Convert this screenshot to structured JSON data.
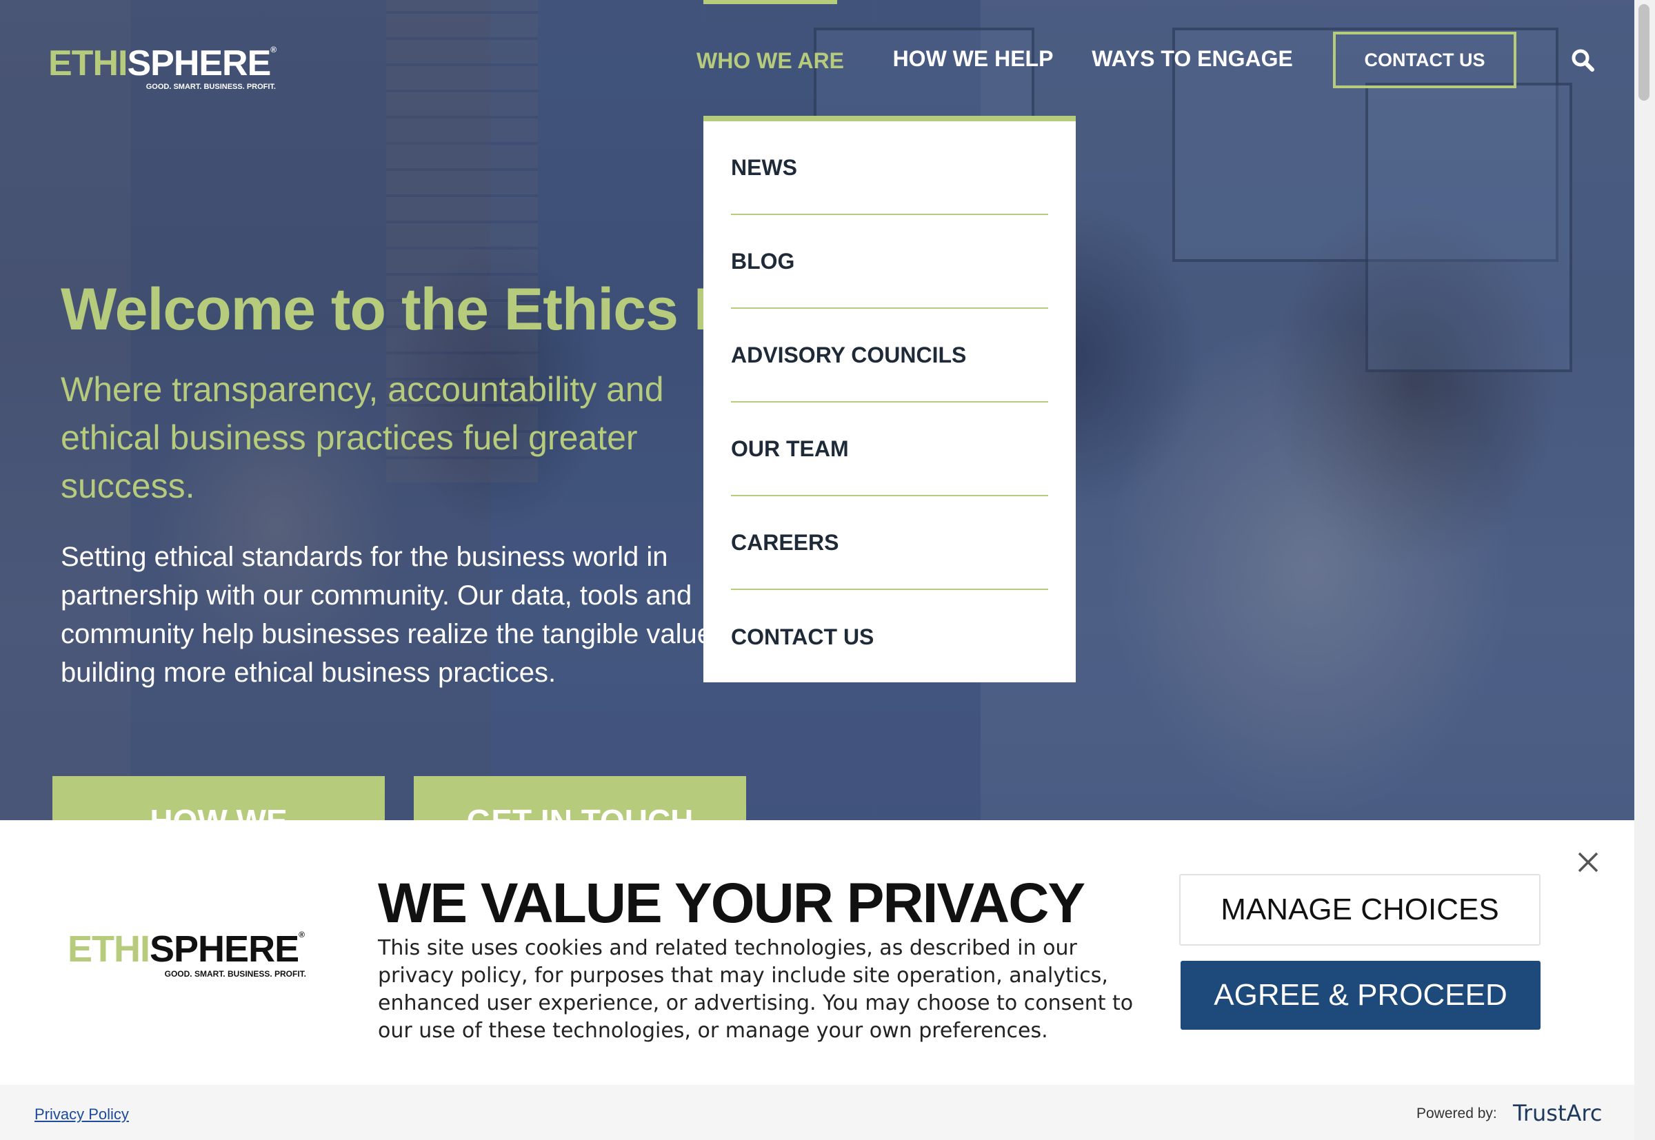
{
  "header": {
    "logo_main_left": "ETHI",
    "logo_main_right": "SPHERE",
    "logo_tagline": "GOOD. SMART. BUSINESS. PROFIT.",
    "nav": [
      {
        "label": "WHO WE ARE",
        "active": true
      },
      {
        "label": "HOW WE HELP",
        "active": false
      },
      {
        "label": "WAYS TO ENGAGE",
        "active": false
      }
    ],
    "contact_label": "CONTACT US",
    "search_icon": "search-icon"
  },
  "dropdown": {
    "items": [
      "NEWS",
      "BLOG",
      "ADVISORY COUNCILS",
      "OUR TEAM",
      "CAREERS",
      "CONTACT US"
    ]
  },
  "hero": {
    "title": "Welcome to the Ethics Ec",
    "subtitle": "Where transparency, accountability and ethical business practices fuel greater success.",
    "body": "Setting ethical standards for the business world in partnership with our community. Our data, tools and community help businesses realize the tangible value building more ethical business practices.",
    "button_1": "HOW WE",
    "button_2": "GET IN TOUCH"
  },
  "cookie": {
    "logo_left": "ETHI",
    "logo_right": "SPHERE",
    "logo_tagline": "GOOD. SMART. BUSINESS. PROFIT.",
    "title": "WE VALUE YOUR PRIVACY",
    "text": "This site uses cookies and related technologies, as described in our privacy policy, for purposes that may include site operation, analytics, enhanced user experience, or advertising. You may choose to consent to our use of these technologies, or manage your own preferences.",
    "manage_label": "MANAGE CHOICES",
    "agree_label": "AGREE & PROCEED",
    "privacy_link": "Privacy Policy",
    "powered_by": "Powered by:",
    "provider": "TrustArc"
  },
  "colors": {
    "accent": "#b7cb7c",
    "agree_button": "#1d4a7a",
    "hero_tint": "#3b4f78"
  }
}
